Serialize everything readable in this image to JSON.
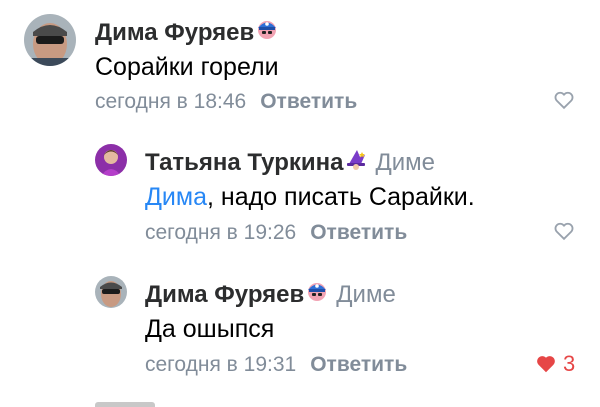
{
  "comments": [
    {
      "author": "Дима Фуряев",
      "badge_icon": "cap-badge-icon",
      "reply_to": "",
      "mention": "",
      "text": "Сорайки горели",
      "time": "сегодня в 18:46",
      "reply_label": "Ответить",
      "liked": false,
      "likes": ""
    },
    {
      "author": "Татьяна Туркина",
      "badge_icon": "witch-badge-icon",
      "reply_to": "Диме",
      "mention": "Дима",
      "text": ", надо писать Сарайки.",
      "time": "сегодня в 19:26",
      "reply_label": "Ответить",
      "liked": false,
      "likes": ""
    },
    {
      "author": "Дима Фуряев",
      "badge_icon": "cap-badge-icon",
      "reply_to": "Диме",
      "mention": "",
      "text": "Да ошыпся",
      "time": "сегодня в 19:31",
      "reply_label": "Ответить",
      "liked": true,
      "likes": "3"
    }
  ],
  "colors": {
    "author": "#2c2d2e",
    "secondary": "#818c99",
    "mention": "#2787f5",
    "like_active": "#e64646"
  }
}
